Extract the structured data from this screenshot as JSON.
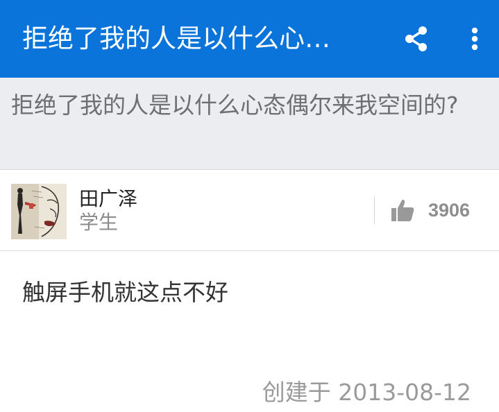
{
  "topbar": {
    "title": "拒绝了我的人是以什么心…",
    "share_icon": "share-icon",
    "more_icon": "more-vertical-icon",
    "background": "#0a74da"
  },
  "question": {
    "text": "拒绝了我的人是以什么心态偶尔来我空间的?"
  },
  "author": {
    "name": "田广泽",
    "title": "学生",
    "avatar_icon": "avatar"
  },
  "likes": {
    "icon": "thumbs-up-icon",
    "count": "3906"
  },
  "answer": {
    "body": "触屏手机就这点不好",
    "created": "创建于 2013-08-12"
  }
}
